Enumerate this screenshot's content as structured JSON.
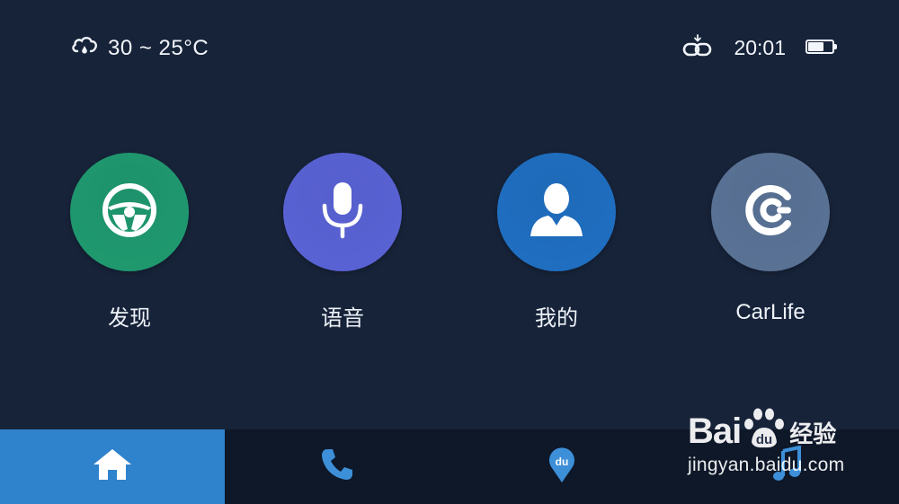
{
  "status_bar": {
    "weather_icon": "cloud-rain-icon",
    "temperature": "30 ~ 25°C",
    "link_icon": "link-icon",
    "time": "20:01",
    "battery_icon": "battery-icon",
    "battery_level": 0.7
  },
  "apps": [
    {
      "label": "发现",
      "icon": "steering-wheel-icon",
      "color": "#1f9a6f"
    },
    {
      "label": "语音",
      "icon": "microphone-icon",
      "color": "#5a63d6"
    },
    {
      "label": "我的",
      "icon": "user-icon",
      "color": "#1f6fc2"
    },
    {
      "label": "CarLife",
      "icon": "carlife-logo-icon",
      "color": "#5a7396"
    }
  ],
  "bottom_nav": {
    "active_tab": "home",
    "tabs": [
      {
        "id": "home",
        "icon": "home-icon"
      },
      {
        "id": "phone",
        "icon": "phone-icon"
      },
      {
        "id": "map",
        "icon": "map-pin-icon",
        "badge": "du"
      },
      {
        "id": "music",
        "icon": "music-note-icon"
      }
    ]
  },
  "watermark": {
    "brand": "Bai",
    "brand_suffix": "du",
    "chinese": "经验",
    "url": "jingyan.baidu.com"
  },
  "colors": {
    "background": "#172339",
    "nav_background": "#0e1829",
    "nav_active": "#2f82cc"
  }
}
